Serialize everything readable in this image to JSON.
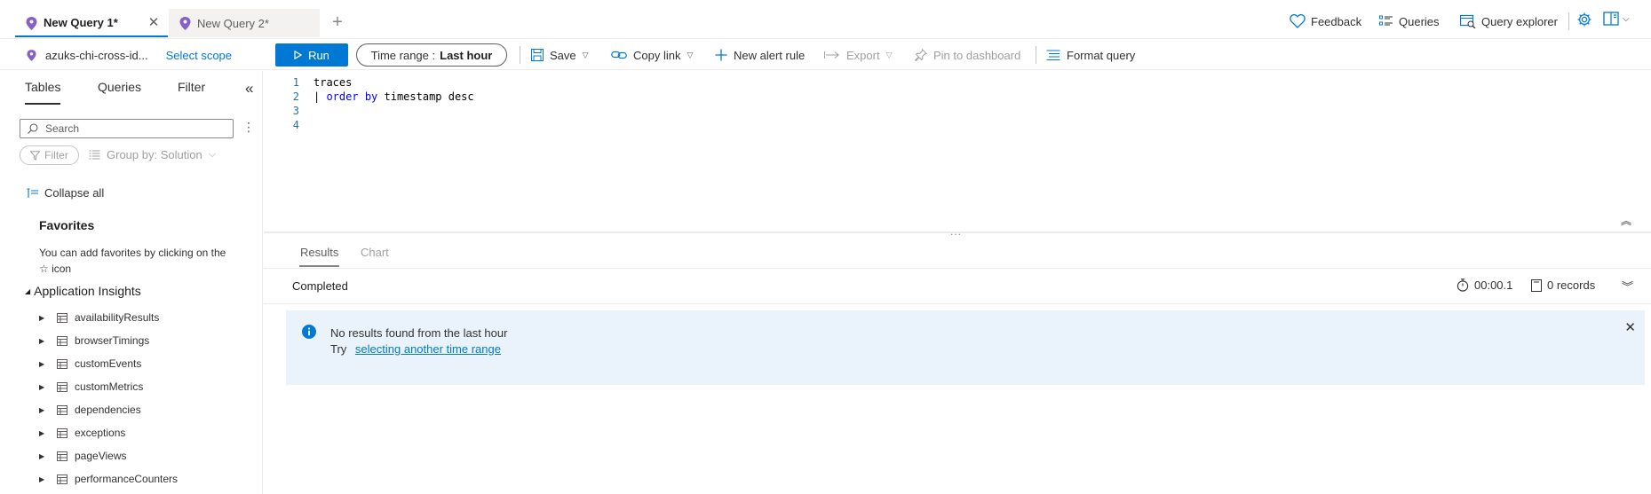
{
  "tabs": [
    {
      "label": "New Query 1*",
      "active": true
    },
    {
      "label": "New Query 2*",
      "active": false
    }
  ],
  "topbar": {
    "feedback": "Feedback",
    "queries": "Queries",
    "query_explorer": "Query explorer"
  },
  "cmdbar": {
    "scope_name": "azuks-chi-cross-id...",
    "select_scope": "Select scope",
    "run": "Run",
    "time_range_label": "Time range :",
    "time_range_value": "Last hour",
    "save": "Save",
    "copy_link": "Copy link",
    "new_alert_rule": "New alert rule",
    "export": "Export",
    "pin_to_dashboard": "Pin to dashboard",
    "format_query": "Format query"
  },
  "left_panel": {
    "tabs": [
      "Tables",
      "Queries",
      "Filter"
    ],
    "search_placeholder": "Search",
    "filter_label": "Filter",
    "group_by": "Group by: Solution",
    "collapse_all": "Collapse all",
    "favorites_title": "Favorites",
    "favorites_hint": "You can add favorites by clicking on the ☆ icon",
    "section_title": "Application Insights",
    "tables": [
      "availabilityResults",
      "browserTimings",
      "customEvents",
      "customMetrics",
      "dependencies",
      "exceptions",
      "pageViews",
      "performanceCounters"
    ]
  },
  "editor": {
    "line_numbers": [
      "1",
      "2",
      "3",
      "4"
    ],
    "line1": "traces",
    "line2_pipe": "| ",
    "line2_kw1": "order",
    "line2_sp": " ",
    "line2_kw2": "by",
    "line2_rest": " timestamp desc",
    "splitter": "..."
  },
  "results": {
    "tabs": [
      "Results",
      "Chart"
    ],
    "status": "Completed",
    "duration": "00:00.1",
    "records": "0 records",
    "message_title": "No results found from the last hour",
    "message_try": "Try",
    "message_link": "selecting another time range"
  },
  "colors": {
    "accent": "#0078d4",
    "pin_purple": "#8661c5",
    "info_background": "#eaf3fb"
  }
}
